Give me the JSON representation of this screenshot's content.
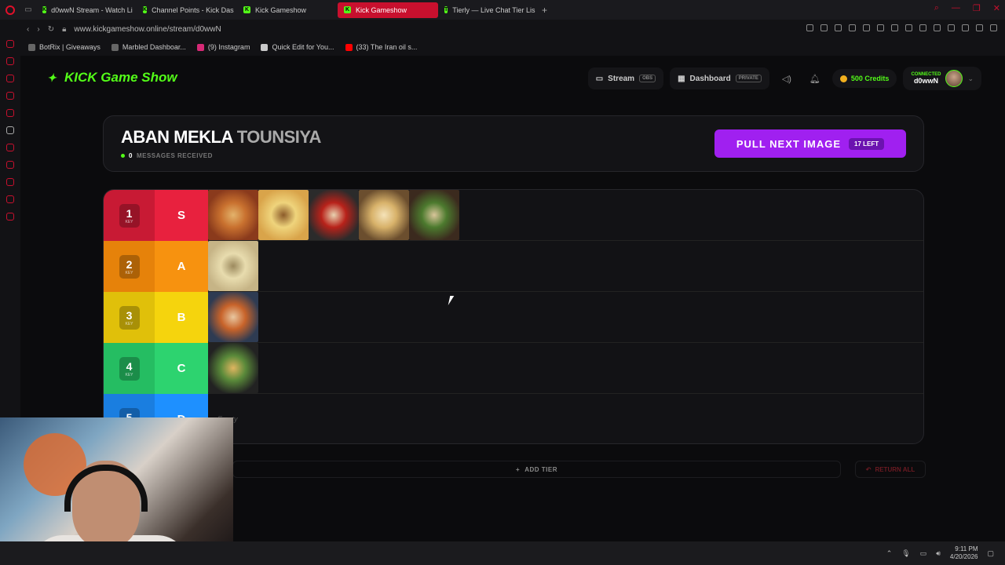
{
  "browser": {
    "tabs": [
      {
        "label": "d0wwN Stream - Watch Li",
        "active": false
      },
      {
        "label": "Channel Points - Kick Das",
        "active": false
      },
      {
        "label": "Kick Gameshow",
        "active": false
      },
      {
        "label": "Kick Gameshow",
        "active": true
      },
      {
        "label": "Tierly — Live Chat Tier Lis",
        "active": false
      }
    ],
    "url": "www.kickgameshow.online/stream/d0wwN",
    "bookmarks": [
      "BotRix | Giveaways",
      "Marbled Dashboar...",
      "(9) Instagram",
      "Quick Edit for You...",
      "(33) The Iran oil s..."
    ]
  },
  "app": {
    "logo": "KICK Game Show",
    "nav": {
      "stream_label": "Stream",
      "stream_pill": "OBS",
      "dashboard_label": "Dashboard",
      "dashboard_pill": "PRIVATE",
      "credits": "500 Credits",
      "connected_label": "CONNECTED",
      "username": "d0wwN"
    },
    "header": {
      "title_main": "ABAN MEKLA",
      "title_dim": "TOUNSIYA",
      "messages_count": "0",
      "messages_label": "MESSAGES RECEIVED",
      "pull_button": "PULL NEXT IMAGE",
      "remaining": "17 LEFT"
    },
    "tiers": [
      {
        "key": "1",
        "key_label": "KEY",
        "label": "S",
        "color": "#e8213e",
        "key_color": "#c81a34",
        "items": [
          "food-tagine",
          "food-lablabi",
          "food-shakshuka",
          "food-egg-stew",
          "food-green-stew"
        ]
      },
      {
        "key": "2",
        "key_label": "KEY",
        "label": "A",
        "color": "#f7920f",
        "key_color": "#e6820a",
        "items": [
          "food-brik"
        ]
      },
      {
        "key": "3",
        "key_label": "KEY",
        "label": "B",
        "color": "#f5d40d",
        "key_color": "#e0c00a",
        "items": [
          "food-soup"
        ]
      },
      {
        "key": "4",
        "key_label": "KEY",
        "label": "C",
        "color": "#2dd36f",
        "key_color": "#25bd62",
        "items": [
          "food-couscous-veg"
        ]
      },
      {
        "key": "5",
        "key_label": "KEY",
        "label": "D",
        "color": "#1e90ff",
        "key_color": "#1a7ee0",
        "items": [],
        "empty_text": "Empty"
      }
    ],
    "add_tier": "ADD TIER",
    "return_all": "RETURN ALL"
  },
  "taskbar": {
    "time": "9:11 PM",
    "date": "4/20/2026"
  }
}
